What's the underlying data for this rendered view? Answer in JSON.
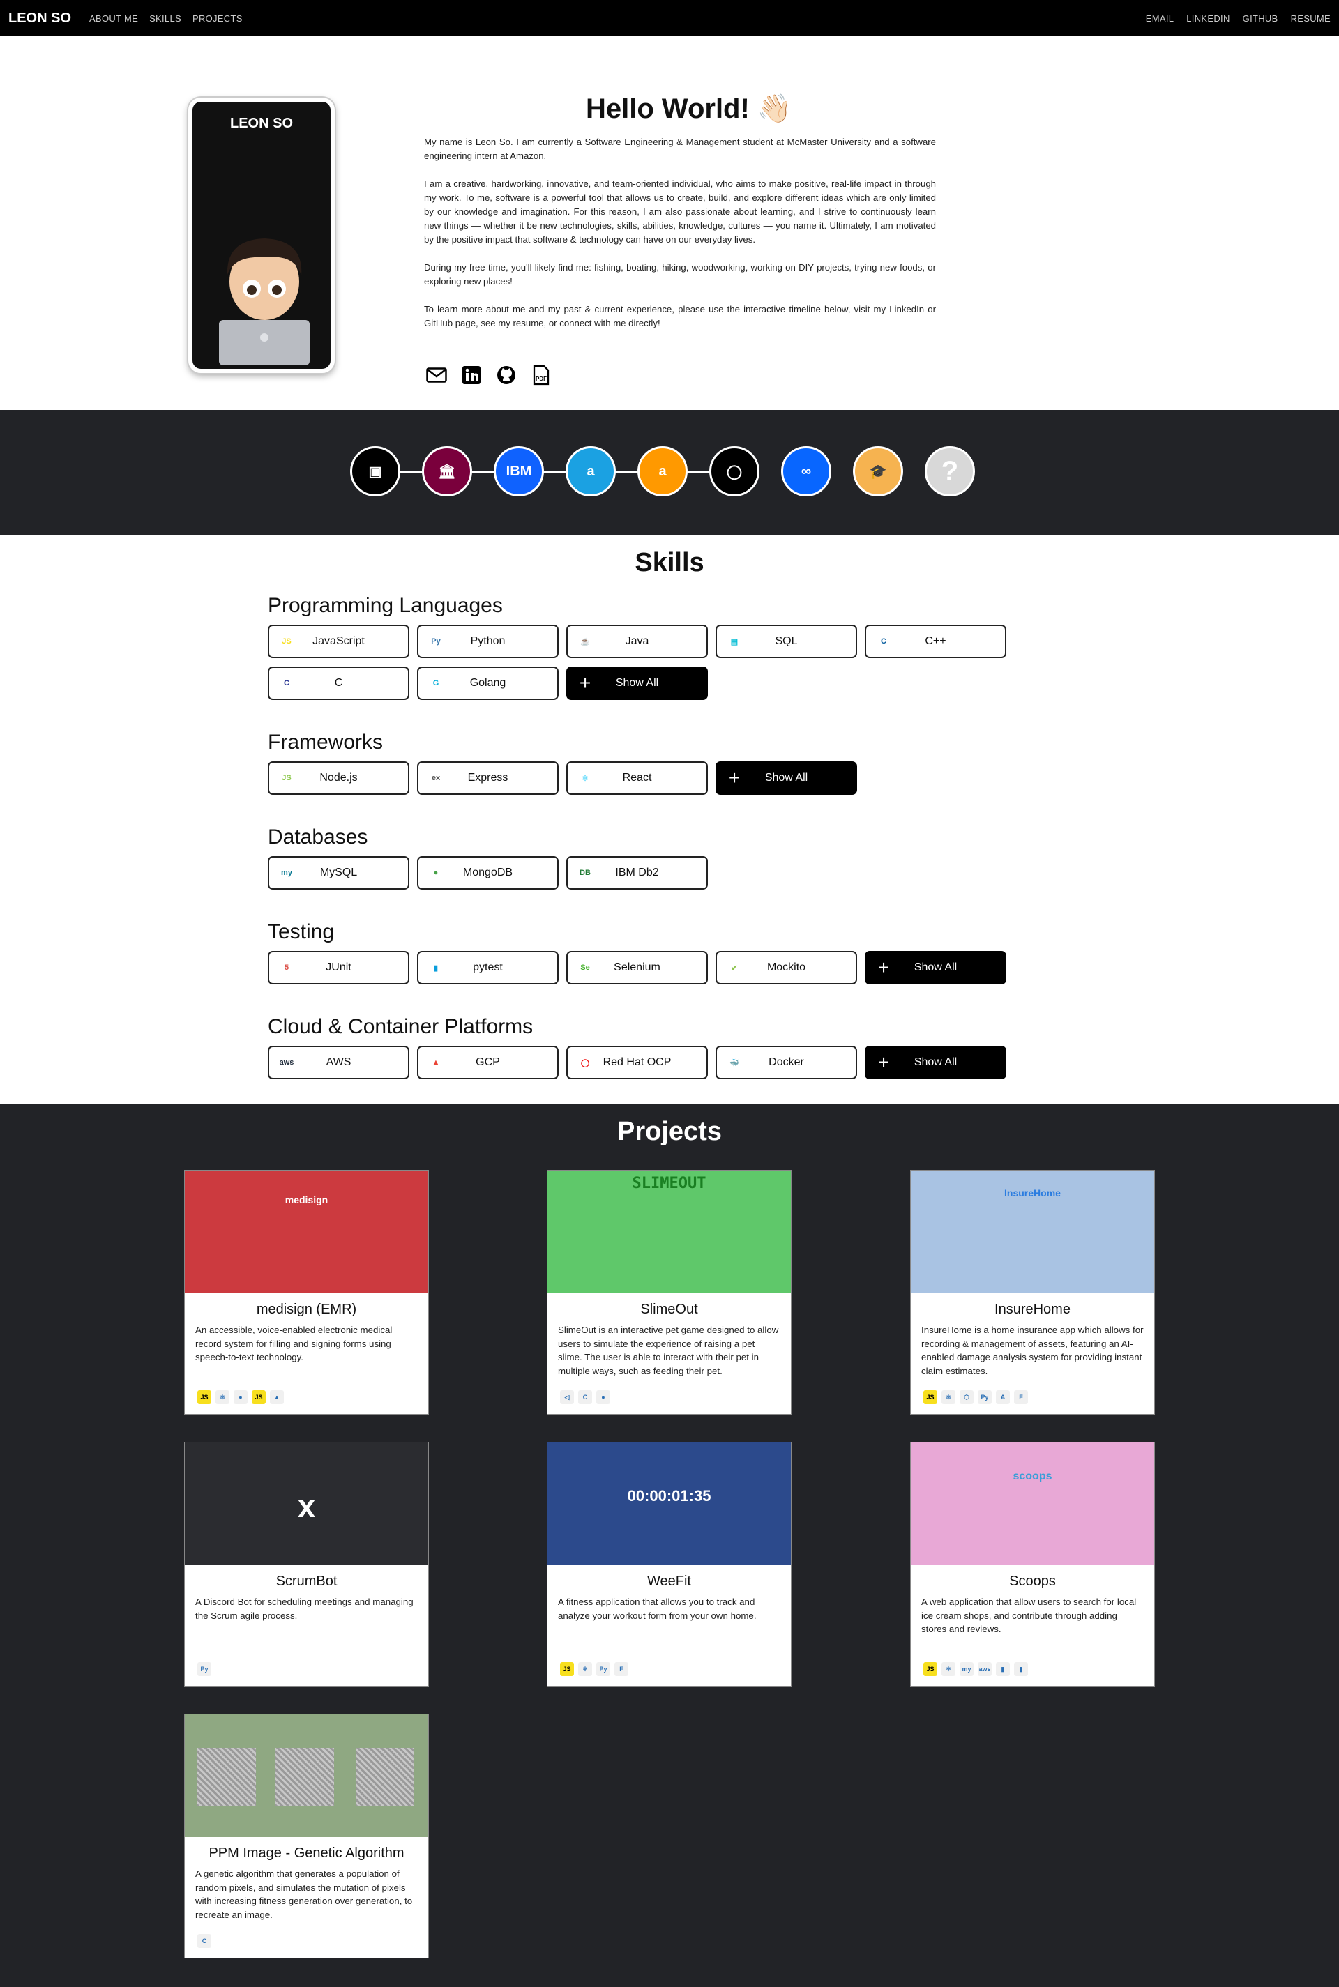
{
  "nav": {
    "brand": "LEON SO",
    "left": [
      "ABOUT ME",
      "SKILLS",
      "PROJECTS"
    ],
    "right": [
      "EMAIL",
      "LINKEDIN",
      "GITHUB",
      "RESUME"
    ]
  },
  "about": {
    "card_name": "LEON SO",
    "heading": "Hello World! 👋🏻",
    "paragraphs": [
      "My name is Leon So. I am currently a Software Engineering & Management student at McMaster University and a software engineering intern at Amazon.",
      "I am a creative, hardworking, innovative, and team-oriented individual, who aims to make positive, real-life impact in through my work. To me, software is a powerful tool that allows us to create, build, and explore different ideas which are only limited by our knowledge and imagination. For this reason, I am also passionate about learning, and I strive to continuously learn new things — whether it be new technologies, skills, abilities, knowledge, cultures — you name it. Ultimately, I am motivated by the positive impact that software & technology can have on our everyday lives.",
      "During my free-time, you'll likely find me: fishing, boating, hiking, woodworking, working on DIY projects, trying new foods, or exploring new places!",
      "To learn more about me and my past & current experience, please use the interactive timeline below, visit my LinkedIn or GitHub page, see my resume, or connect with me directly!"
    ]
  },
  "timeline": [
    {
      "icon": "contact-card-icon",
      "color": "#000000",
      "text": "▣"
    },
    {
      "icon": "university-icon",
      "color": "#7a003c",
      "text": "🏛"
    },
    {
      "icon": "ibm-icon",
      "color": "#0f62fe",
      "text": "IBM"
    },
    {
      "icon": "amazon-icon",
      "color": "#1ba1e2",
      "text": "a"
    },
    {
      "icon": "amazon-icon",
      "color": "#ff9900",
      "text": "a"
    },
    {
      "icon": "ring-icon",
      "color": "#000000",
      "text": "◯"
    },
    {
      "icon": "meta-icon",
      "color": "#0866ff",
      "text": "∞"
    },
    {
      "icon": "graduation-cap-icon",
      "color": "#f6b350",
      "text": "🎓"
    },
    {
      "icon": "question-icon",
      "color": "#d8d8d8",
      "text": "?"
    }
  ],
  "skills": {
    "title": "Skills",
    "categories": [
      {
        "name": "Programming Languages",
        "items": [
          [
            "JavaScript",
            "JS",
            "#f7df1e"
          ],
          [
            "Python",
            "Py",
            "#3776ab"
          ],
          [
            "Java",
            "☕",
            "#e76f00"
          ],
          [
            "SQL",
            "▤",
            "#00bcd4"
          ],
          [
            "C++",
            "C",
            "#00599c"
          ],
          [
            "C",
            "C",
            "#283593"
          ],
          [
            "Golang",
            "G",
            "#00add8"
          ]
        ],
        "more": "Show All"
      },
      {
        "name": "Frameworks",
        "items": [
          [
            "Node.js",
            "JS",
            "#8cc84b"
          ],
          [
            "Express",
            "ex",
            "#555555"
          ],
          [
            "React",
            "⚛",
            "#61dafb"
          ]
        ],
        "more": "Show All"
      },
      {
        "name": "Databases",
        "items": [
          [
            "MySQL",
            "my",
            "#00758f"
          ],
          [
            "MongoDB",
            "●",
            "#47a248"
          ],
          [
            "IBM Db2",
            "DB",
            "#1f7a33"
          ]
        ],
        "more": ""
      },
      {
        "name": "Testing",
        "items": [
          [
            "JUnit",
            "5",
            "#dc524a"
          ],
          [
            "pytest",
            "▮",
            "#0a9edc"
          ],
          [
            "Selenium",
            "Se",
            "#43b02a"
          ],
          [
            "Mockito",
            "✔",
            "#8bc34a"
          ]
        ],
        "more": "Show All"
      },
      {
        "name": "Cloud & Container Platforms",
        "items": [
          [
            "AWS",
            "aws",
            "#232f3e"
          ],
          [
            "GCP",
            "▲",
            "#ea4335"
          ],
          [
            "Red Hat OCP",
            "◯",
            "#ee0000"
          ],
          [
            "Docker",
            "🐳",
            "#2496ed"
          ]
        ],
        "more": "Show All"
      }
    ]
  },
  "projects": {
    "title": "Projects",
    "cards": [
      {
        "title": "medisign (EMR)",
        "desc": "An accessible, voice-enabled electronic medical record system for filling and signing forms using speech-to-text technology.",
        "bg": "#cc3a3f",
        "label": "medisign",
        "tech": [
          "JS",
          "⚛",
          "●",
          "JS",
          "▲"
        ]
      },
      {
        "title": "SlimeOut",
        "desc": "SlimeOut is an interactive pet game designed to allow users to simulate the experience of raising a pet slime. The user is able to interact with their pet in multiple ways, such as feeding their pet.",
        "bg": "#5fc86a",
        "label": "SLIMEOUT",
        "tech": [
          "◁",
          "C",
          "●"
        ]
      },
      {
        "title": "InsureHome",
        "desc": "InsureHome is a home insurance app which allows for recording & management of assets, featuring an AI-enabled damage analysis system for providing instant claim estimates.",
        "bg": "#a9c3e3",
        "label": "InsureHome",
        "tech": [
          "JS",
          "⚛",
          "⬡",
          "Py",
          "A",
          "F"
        ]
      },
      {
        "title": "ScrumBot",
        "desc": "A Discord Bot for scheduling meetings and managing the Scrum agile process.",
        "bg": "#2b2c30",
        "label": "x",
        "tech": [
          "Py"
        ]
      },
      {
        "title": "WeeFit",
        "desc": "A fitness application that allows you to track and analyze your workout form from your own home.",
        "bg": "#2c4a8c",
        "label": "00:00:01:35",
        "tech": [
          "JS",
          "⚛",
          "Py",
          "F"
        ]
      },
      {
        "title": "Scoops",
        "desc": "A web application that allow users to search for local ice cream shops, and contribute through adding stores and reviews.",
        "bg": "#e8a8d6",
        "label": "scoops",
        "tech": [
          "JS",
          "⚛",
          "my",
          "aws",
          "▮",
          "▮"
        ]
      },
      {
        "title": "PPM Image - Genetic Algorithm",
        "desc": "A genetic algorithm that generates a population of random pixels, and simulates the mutation of pixels with increasing fitness generation over generation, to recreate an image.",
        "bg": "#8fa882",
        "label": "",
        "tech": [
          "C"
        ]
      }
    ]
  }
}
